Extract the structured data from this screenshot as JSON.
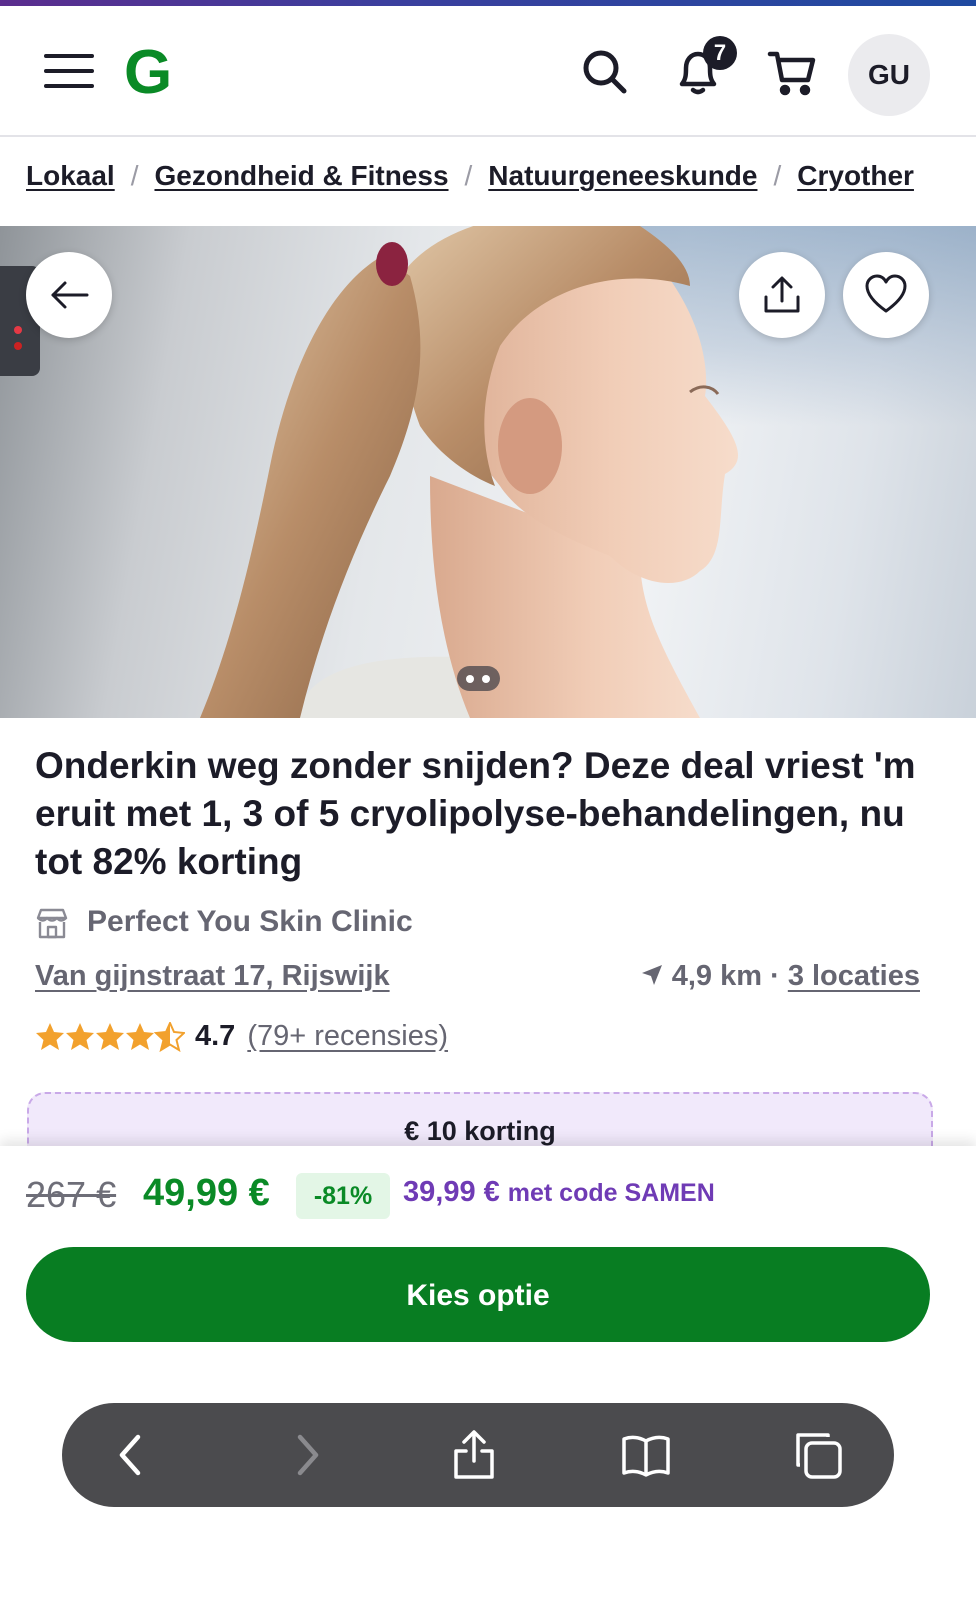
{
  "header": {
    "notification_count": "7",
    "avatar_initials": "GU",
    "logo_letter": "G"
  },
  "breadcrumb": {
    "items": [
      "Lokaal",
      "Gezondheid & Fitness",
      "Natuurgeneeskunde",
      "Cryother"
    ],
    "separator": "/"
  },
  "hero": {
    "image_count": 2,
    "current_image": 1
  },
  "deal": {
    "title": "Onderkin weg zonder snijden? Deze deal vriest 'm eruit met 1, 3 of 5 cryolipolyse-behandelingen, nu tot 82% korting",
    "merchant": "Perfect You Skin Clinic",
    "address": "Van gijnstraat 17, Rijswijk",
    "distance": "4,9 km",
    "distance_sep": "·",
    "locations": "3 locaties",
    "rating": "4.7",
    "rating_stars": 4.5,
    "reviews": "(79+ recensies)",
    "promo_banner": "€ 10 korting"
  },
  "pricing": {
    "old_price": "267 €",
    "new_price": "49,99 €",
    "discount": "-81%",
    "code_price": "39,99 €",
    "code_text": "met code SAMEN",
    "cta_label": "Kies optie"
  },
  "colors": {
    "brand_green": "#0a8a26",
    "cta_green": "#087d22",
    "promo_purple": "#6f3bb5",
    "star_orange": "#f2a12d"
  },
  "icons": {
    "header": [
      "menu-icon",
      "groupon-logo",
      "search-icon",
      "bell-icon",
      "cart-icon"
    ],
    "hero": [
      "arrow-left-icon",
      "share-icon",
      "heart-icon"
    ],
    "browser": [
      "chevron-left-icon",
      "chevron-right-icon",
      "share-icon",
      "book-icon",
      "tabs-icon"
    ]
  }
}
